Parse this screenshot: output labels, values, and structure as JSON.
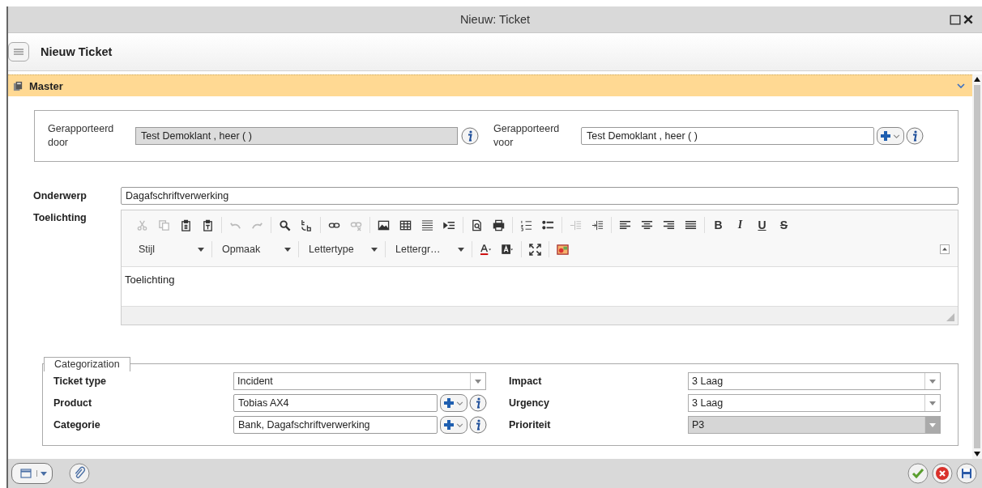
{
  "window": {
    "title": "Nieuw: Ticket"
  },
  "header": {
    "title": "Nieuw Ticket"
  },
  "section": {
    "title": "Master",
    "expanded": true
  },
  "reported": [
    {
      "label": "Gerapporteerd door",
      "value": "Test Demoklant , heer (  )",
      "kind": "readonly"
    },
    {
      "label": "Gerapporteerd voor",
      "value": "Test Demoklant , heer (  )",
      "kind": "lookup"
    }
  ],
  "subject": {
    "label": "Onderwerp",
    "value": "Dagafschriftverwerking"
  },
  "description": {
    "label": "Toelichting",
    "toolbar": [
      [
        {
          "kind": "cut",
          "disabled": true
        },
        {
          "kind": "copy",
          "disabled": true
        },
        {
          "kind": "paste",
          "disabled": false
        },
        {
          "kind": "paste-text",
          "disabled": false
        }
      ],
      [
        {
          "kind": "undo",
          "disabled": true
        },
        {
          "kind": "redo",
          "disabled": true
        }
      ],
      [
        {
          "kind": "find",
          "disabled": false
        },
        {
          "kind": "replace",
          "disabled": false
        }
      ],
      [
        {
          "kind": "link",
          "disabled": false
        },
        {
          "kind": "unlink",
          "disabled": true
        }
      ],
      [
        {
          "kind": "image",
          "disabled": false
        },
        {
          "kind": "table",
          "disabled": false
        },
        {
          "kind": "hline",
          "disabled": false
        },
        {
          "kind": "blockquote",
          "disabled": false
        }
      ],
      [
        {
          "kind": "preview",
          "disabled": false
        },
        {
          "kind": "print",
          "disabled": false
        }
      ],
      [
        {
          "kind": "ol",
          "disabled": false
        },
        {
          "kind": "ul",
          "disabled": false
        }
      ],
      [
        {
          "kind": "outdent",
          "disabled": true
        },
        {
          "kind": "indent",
          "disabled": false
        }
      ],
      [
        {
          "kind": "align-left",
          "disabled": false
        },
        {
          "kind": "align-center",
          "disabled": false
        },
        {
          "kind": "align-right",
          "disabled": false
        },
        {
          "kind": "justify",
          "disabled": false
        }
      ],
      [
        {
          "kind": "bold",
          "label": "B",
          "disabled": false
        },
        {
          "kind": "italic",
          "label": "I",
          "disabled": false
        },
        {
          "kind": "underline",
          "label": "U",
          "disabled": false
        },
        {
          "kind": "strike",
          "label": "S",
          "disabled": false
        }
      ]
    ],
    "combos": [
      "Stijl",
      "Opmaak",
      "Lettertype",
      "Lettergr…"
    ],
    "toolbar2": [
      [
        {
          "kind": "text-color",
          "disabled": false
        },
        {
          "kind": "bg-color",
          "disabled": false
        }
      ],
      [
        {
          "kind": "maximize",
          "disabled": false
        }
      ],
      [
        {
          "kind": "picture",
          "disabled": false
        }
      ]
    ],
    "content": "Toelichting"
  },
  "categorization": {
    "legend": "Categorization",
    "fields": [
      {
        "label": "Ticket type",
        "value": "Incident",
        "kind": "select",
        "disabled": false
      },
      {
        "label": "Impact",
        "value": "3 Laag",
        "kind": "select",
        "disabled": false
      },
      {
        "label": "Product",
        "value": "Tobias AX4",
        "kind": "lookup",
        "disabled": false
      },
      {
        "label": "Urgency",
        "value": "3 Laag",
        "kind": "select",
        "disabled": false
      },
      {
        "label": "Categorie",
        "value": "Bank, Dagafschriftverwerking",
        "kind": "lookup",
        "disabled": false
      },
      {
        "label": "Prioriteit",
        "value": "P3",
        "kind": "select",
        "disabled": true
      }
    ]
  }
}
